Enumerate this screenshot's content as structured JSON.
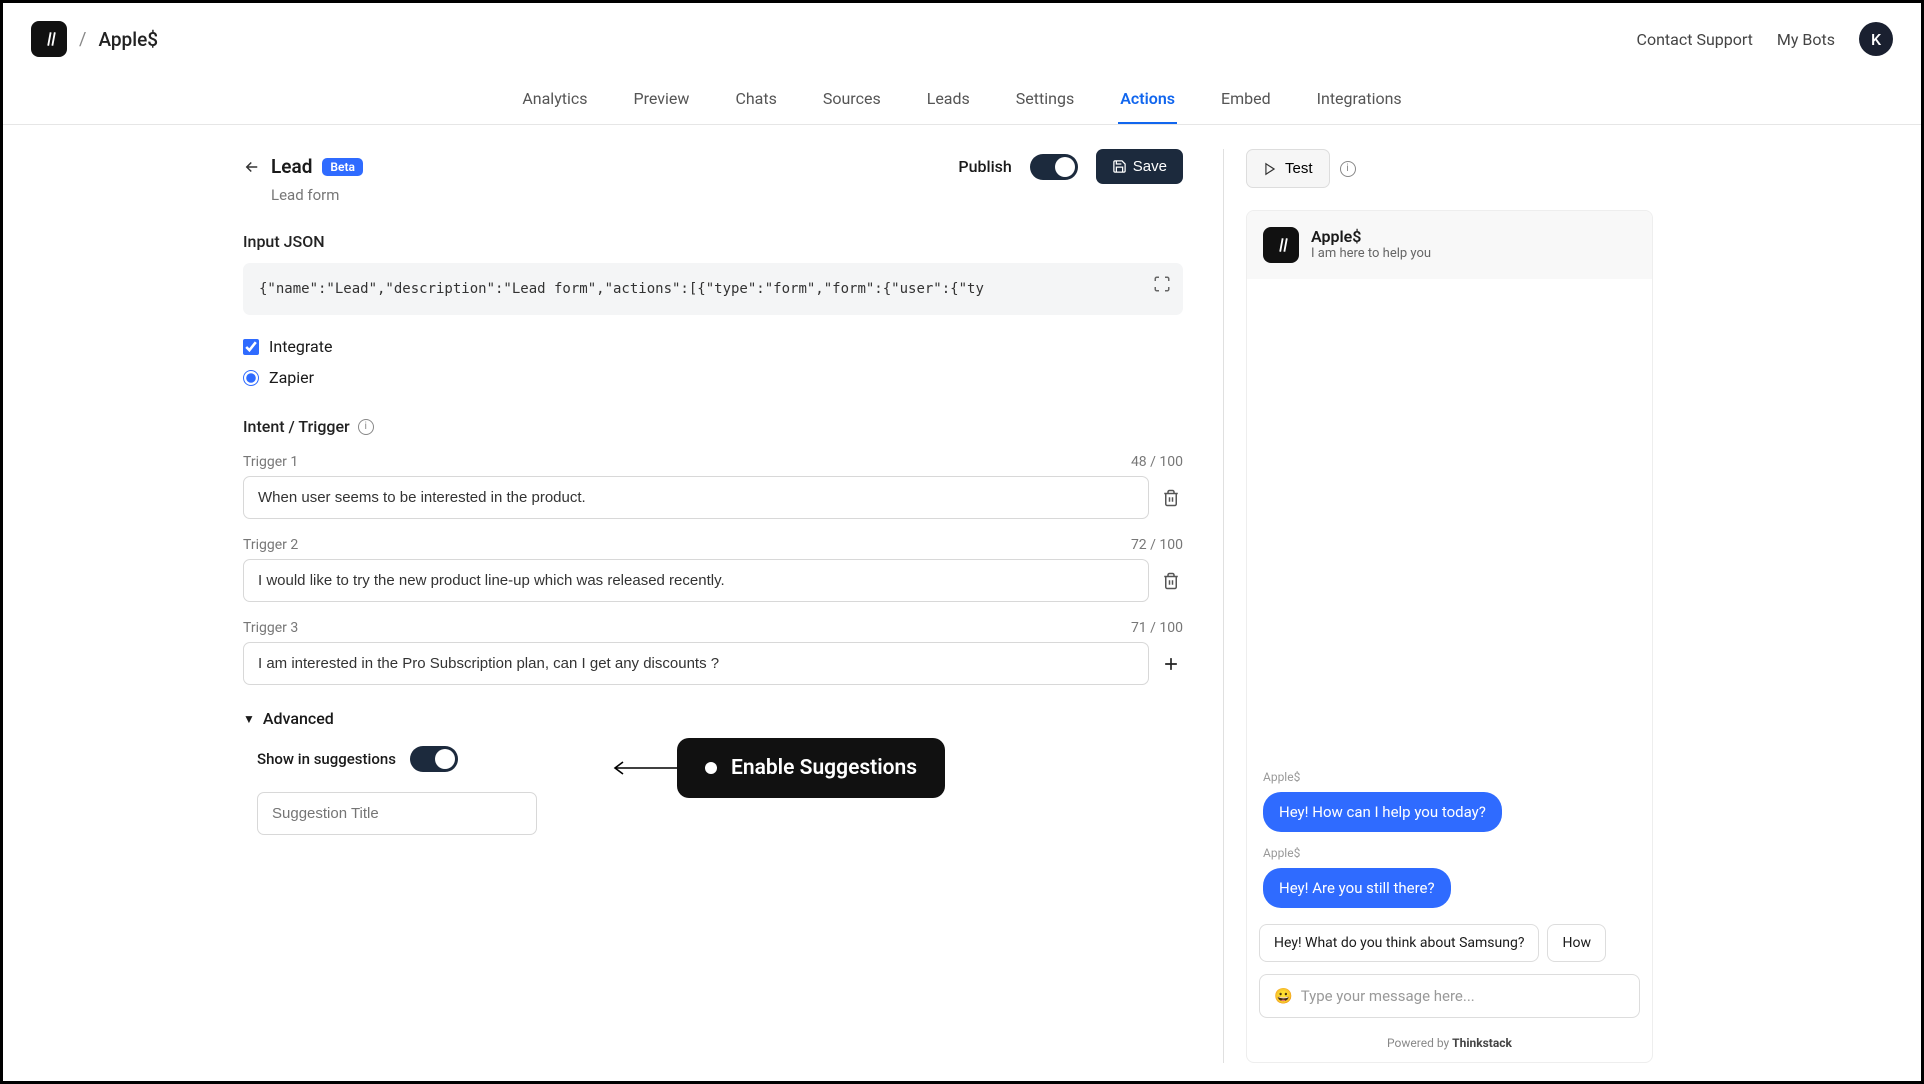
{
  "header": {
    "bot_name": "Apple$",
    "contact": "Contact Support",
    "my_bots": "My Bots",
    "avatar_letter": "K"
  },
  "tabs": [
    "Analytics",
    "Preview",
    "Chats",
    "Sources",
    "Leads",
    "Settings",
    "Actions",
    "Embed",
    "Integrations"
  ],
  "active_tab": "Actions",
  "action": {
    "title": "Lead",
    "badge": "Beta",
    "subtitle": "Lead form",
    "publish_label": "Publish",
    "save_label": "Save",
    "json_label": "Input JSON",
    "json_value": "{\"name\":\"Lead\",\"description\":\"Lead form\",\"actions\":[{\"type\":\"form\",\"form\":{\"user\":{\"ty",
    "integrate_label": "Integrate",
    "zapier_label": "Zapier",
    "intent_label": "Intent / Trigger",
    "triggers": [
      {
        "label": "Trigger 1",
        "count": "48 / 100",
        "value": "When user seems to be interested in the product."
      },
      {
        "label": "Trigger 2",
        "count": "72 / 100",
        "value": "I would like to try the new product line-up which was released recently."
      },
      {
        "label": "Trigger 3",
        "count": "71 / 100",
        "value": "I am interested in the Pro Subscription plan, can I get any discounts ?"
      }
    ],
    "advanced_label": "Advanced",
    "show_suggestions_label": "Show in suggestions",
    "suggestion_placeholder": "Suggestion Title",
    "callout": "Enable Suggestions"
  },
  "preview": {
    "test_label": "Test",
    "bot_title": "Apple$",
    "bot_sub": "I am here to help you",
    "sender": "Apple$",
    "msg1": "Hey! How can I help you today?",
    "msg2": "Hey! Are you still there?",
    "sugg1": "Hey! What do you think about Samsung?",
    "sugg2": "How",
    "input_placeholder": "Type your message here...",
    "emoji": "😀",
    "powered_by": "Powered by ",
    "brand": "Thinkstack"
  }
}
